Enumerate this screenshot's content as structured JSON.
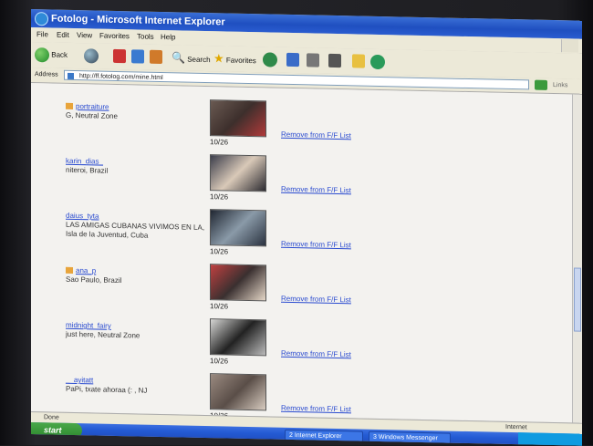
{
  "window": {
    "title": "Fotolog - Microsoft Internet Explorer"
  },
  "menu": [
    "File",
    "Edit",
    "View",
    "Favorites",
    "Tools",
    "Help"
  ],
  "toolbar": {
    "back": "Back",
    "search": "Search",
    "favorites": "Favorites"
  },
  "address": {
    "label": "Address",
    "url": "http://ff.fotolog.com/mine.html",
    "links": "Links"
  },
  "entries": [
    {
      "username": "portraiture",
      "location": "G, Neutral Zone",
      "date": "10/26",
      "action": "Remove from F/F List",
      "badge": true,
      "img_colors": [
        "#6a5a52",
        "#3d2f2c",
        "#b03a3a"
      ]
    },
    {
      "username": "karin_dias_",
      "location": "niteroi, Brazil",
      "date": "10/26",
      "action": "Remove from F/F List",
      "badge": false,
      "img_colors": [
        "#3a3c4a",
        "#d9c9b8",
        "#2b2a30"
      ]
    },
    {
      "username": "daius_tyta",
      "location": "LAS AMIGAS CUBANAS VIVIMOS EN LA, Isla de la Juventud, Cuba",
      "date": "10/26",
      "action": "Remove from F/F List",
      "badge": false,
      "img_colors": [
        "#1f2530",
        "#8a9aa8",
        "#2b3340"
      ]
    },
    {
      "username": "ana_p",
      "location": "Sao Paulo, Brazil",
      "date": "10/26",
      "action": "Remove from F/F List",
      "badge": true,
      "img_colors": [
        "#c04040",
        "#3a3030",
        "#e6d8c8"
      ]
    },
    {
      "username": "midnight_fairy",
      "location": "just here, Neutral Zone",
      "date": "10/26",
      "action": "Remove from F/F List",
      "badge": false,
      "img_colors": [
        "#d7d7d5",
        "#222",
        "#bbb"
      ]
    },
    {
      "username": "__ayitatt",
      "location": "PaPi, txate ahoraa (: , NJ",
      "date": "10/26",
      "action": "Remove from F/F List",
      "badge": false,
      "img_colors": [
        "#9a8a80",
        "#5a4e48",
        "#d8ccc0"
      ]
    }
  ],
  "status": {
    "left": "Done",
    "zone": "Internet"
  },
  "taskbar": {
    "start": "start",
    "tasks": [
      "2 Internet Explorer",
      "3 Windows Messenger"
    ]
  }
}
